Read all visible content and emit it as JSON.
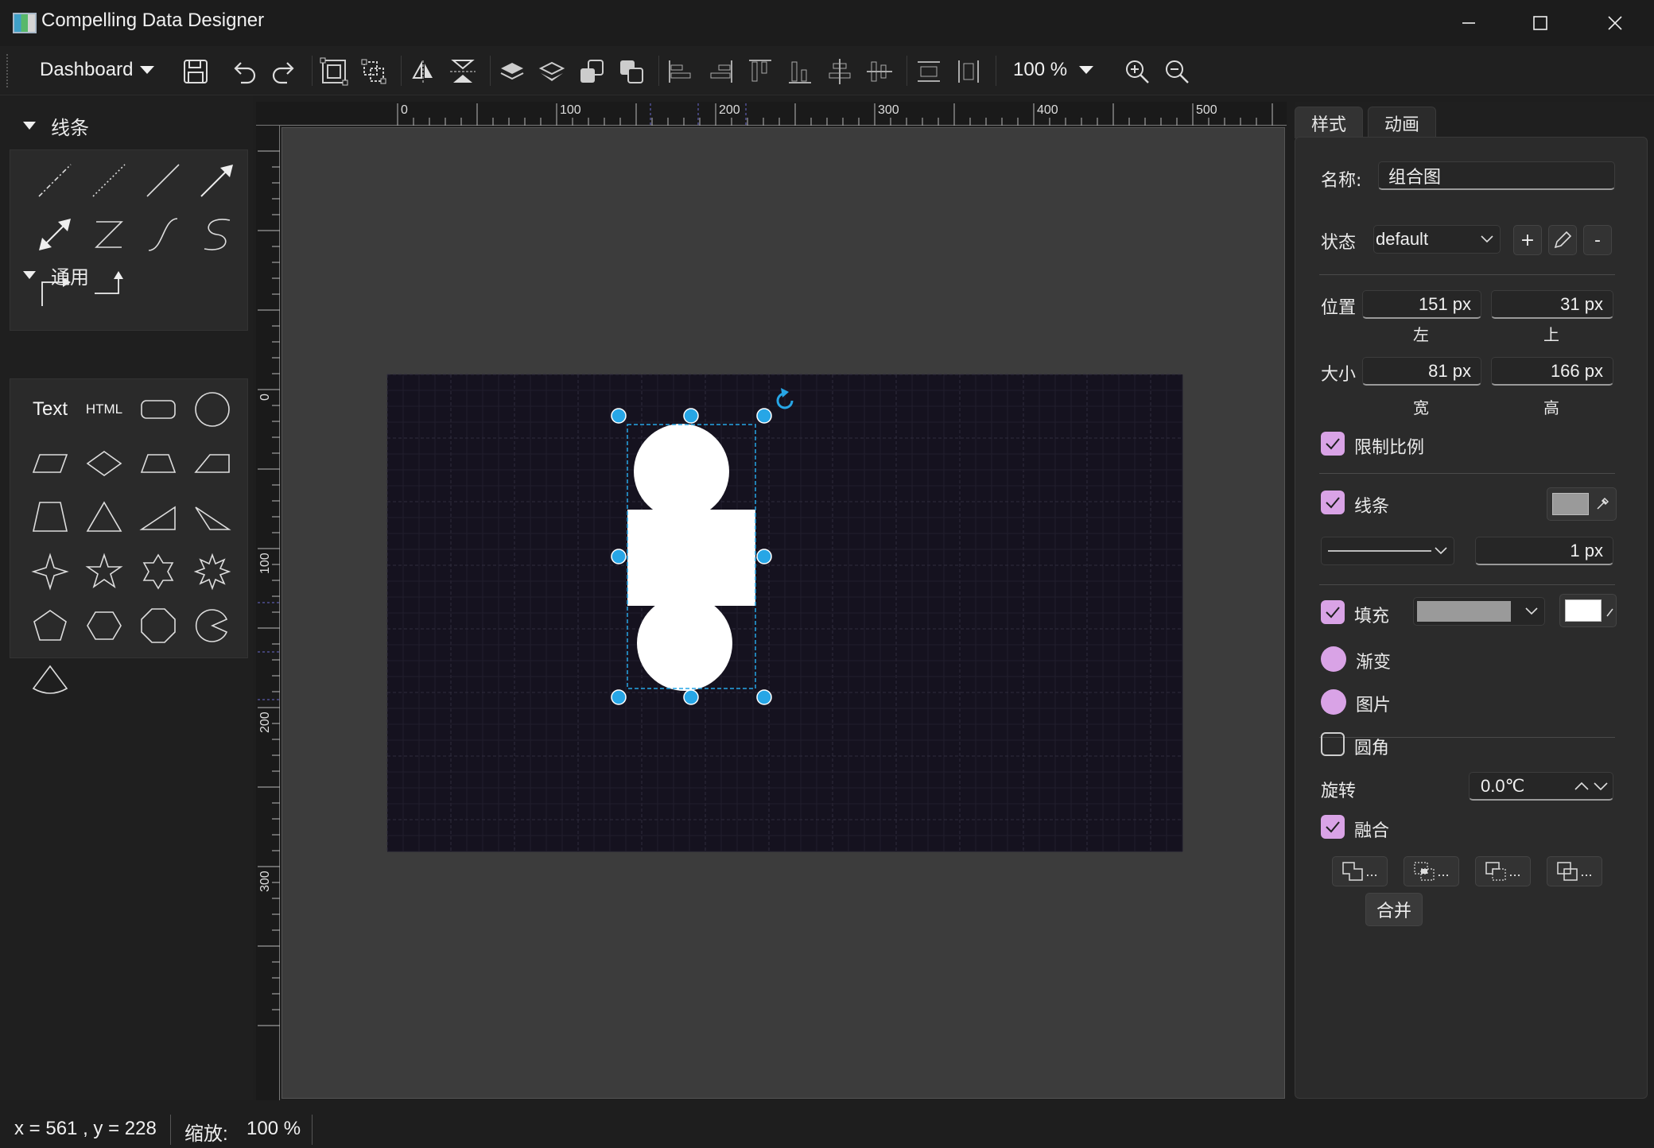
{
  "window": {
    "title": "Compelling Data Designer",
    "controls": [
      "minimize",
      "maximize",
      "close"
    ]
  },
  "toolbar": {
    "page_selector": "Dashboard",
    "zoom": "100 %",
    "icons": [
      "save-icon",
      "undo-icon",
      "redo-icon",
      "group-icon",
      "ungroup-icon",
      "flip-horizontal-icon",
      "flip-vertical-icon",
      "bring-forward-icon",
      "send-backward-icon",
      "bring-to-front-icon",
      "send-to-back-icon",
      "align-left-icon",
      "align-right-icon",
      "align-top-icon",
      "align-bottom-icon",
      "align-center-horizontal-icon",
      "align-center-vertical-icon",
      "distribute-horizontal-icon",
      "distribute-vertical-icon",
      "zoom-in-icon",
      "zoom-out-icon"
    ]
  },
  "left_panel": {
    "lines_section": "线条",
    "common_section": "通用",
    "common_text_items": [
      "Text",
      "HTML"
    ]
  },
  "ruler": {
    "h_labels": [
      "0",
      "100",
      "200",
      "300",
      "400",
      "500"
    ],
    "v_labels": [
      "0",
      "100",
      "200",
      "300"
    ]
  },
  "right_panel": {
    "tabs": [
      "样式",
      "动画"
    ],
    "name_label": "名称:",
    "name_value": "组合图",
    "state_label": "状态",
    "state_value": "default",
    "state_add": "+",
    "state_remove": "-",
    "position_label": "位置",
    "left_value": "151 px",
    "top_value": "31 px",
    "left_caption": "左",
    "top_caption": "上",
    "size_label": "大小",
    "width_value": "81 px",
    "height_value": "166 px",
    "width_caption": "宽",
    "height_caption": "高",
    "lock_ratio_label": "限制比例",
    "lock_ratio_checked": true,
    "stroke_label": "线条",
    "stroke_checked": true,
    "stroke_color": "#9a9a9a",
    "stroke_width": "1 px",
    "fill_label": "填充",
    "fill_checked": true,
    "fill_color": "#9a9a9a",
    "fill_swatch": "#ffffff",
    "gradient_label": "渐变",
    "image_label": "图片",
    "rounded_label": "圆角",
    "rounded_checked": false,
    "rotate_label": "旋转",
    "rotate_value": "0.0℃",
    "merge_label": "融合",
    "merge_checked": true,
    "merge_mode_more": "...",
    "merge_button": "合并"
  },
  "status": {
    "coords": "x = 561 , y = 228",
    "zoom_label": "缩放:",
    "zoom_value": "100 %"
  },
  "colors": {
    "accent": "#d9a3e6",
    "handle": "#27a6e6",
    "canvas": "#15121f"
  }
}
